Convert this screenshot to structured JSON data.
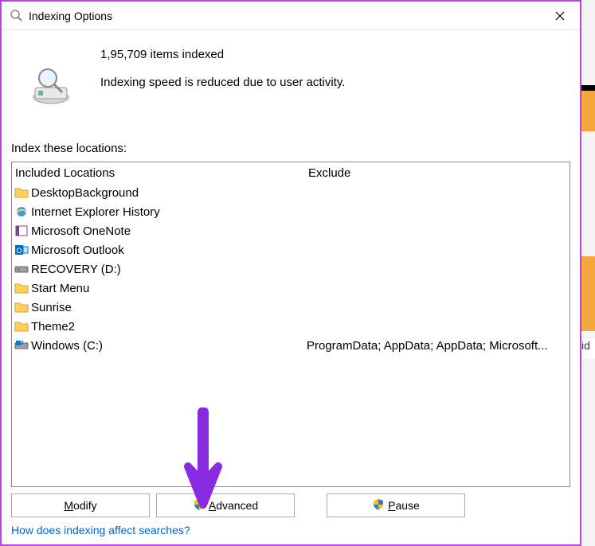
{
  "window": {
    "title": "Indexing Options"
  },
  "status": {
    "count_line": "1,95,709 items indexed",
    "speed_line": "Indexing speed is reduced due to user activity."
  },
  "section_label": "Index these locations:",
  "columns": {
    "included": "Included Locations",
    "exclude": "Exclude"
  },
  "locations": [
    {
      "icon": "folder",
      "name": "DesktopBackground",
      "exclude": ""
    },
    {
      "icon": "ie",
      "name": "Internet Explorer History",
      "exclude": ""
    },
    {
      "icon": "onenote",
      "name": "Microsoft OneNote",
      "exclude": ""
    },
    {
      "icon": "outlook",
      "name": "Microsoft Outlook",
      "exclude": ""
    },
    {
      "icon": "drive",
      "name": "RECOVERY (D:)",
      "exclude": ""
    },
    {
      "icon": "folder",
      "name": "Start Menu",
      "exclude": ""
    },
    {
      "icon": "folder",
      "name": "Sunrise",
      "exclude": ""
    },
    {
      "icon": "folder",
      "name": "Theme2",
      "exclude": ""
    },
    {
      "icon": "drive-win",
      "name": "Windows (C:)",
      "exclude": "ProgramData; AppData; AppData; Microsoft..."
    }
  ],
  "buttons": {
    "modify": {
      "pre": "",
      "u": "M",
      "post": "odify"
    },
    "advanced": {
      "pre": "",
      "u": "A",
      "post": "dvanced"
    },
    "pause": {
      "pre": "",
      "u": "P",
      "post": "ause"
    }
  },
  "help_link": "How does indexing affect searches?",
  "bg_text": "id"
}
